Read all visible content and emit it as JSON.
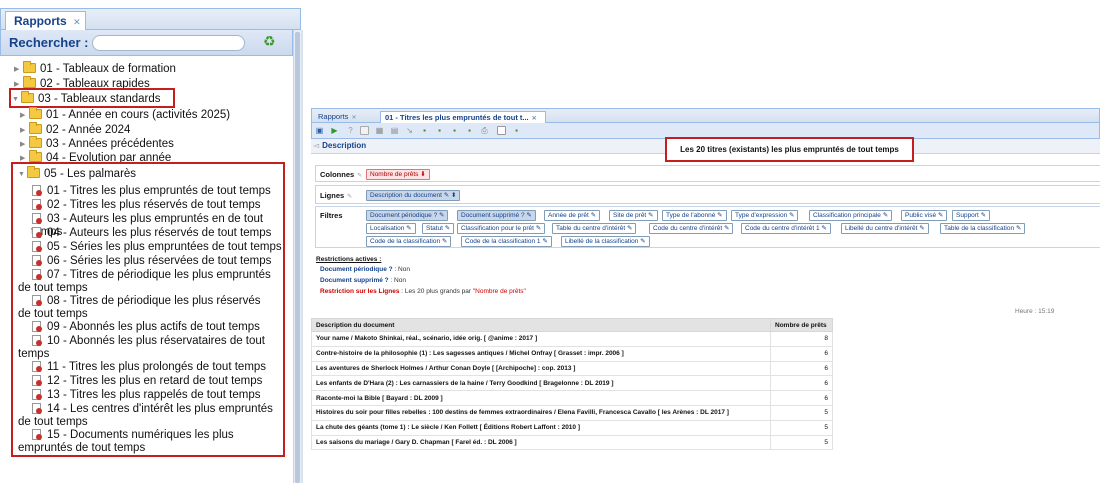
{
  "left": {
    "tab_label": "Rapports",
    "search_label": "Rechercher :",
    "search_value": "",
    "tree": [
      {
        "label": "01 - Tableaux de formation",
        "expanded": false
      },
      {
        "label": "02 - Tableaux rapides",
        "expanded": false
      },
      {
        "label": "03 - Tableaux standards",
        "expanded": true
      }
    ],
    "subtree": [
      {
        "label": "01 - Année en cours (activités 2025)",
        "expanded": false
      },
      {
        "label": "02 - Année 2024",
        "expanded": false
      },
      {
        "label": "03 - Années précédentes",
        "expanded": false
      },
      {
        "label": "04 - Evolution par année",
        "expanded": false
      },
      {
        "label": "05 - Les palmarès",
        "expanded": true
      }
    ],
    "reports": [
      "01 - Titres les plus empruntés de tout temps",
      "02 - Titres les plus réservés de tout temps",
      "03 - Auteurs les plus empruntés en de tout temps",
      "04 - Auteurs les plus réservés de tout temps",
      "05 - Séries les plus empruntées de tout temps",
      "06 - Séries les plus réservées de tout temps",
      "07 - Titres de périodique les plus empruntés de tout temps",
      "08 - Titres de périodique les plus réservés de tout temps",
      "09 - Abonnés les plus actifs de tout temps",
      "10 - Abonnés les plus réservataires de tout temps",
      "11 - Titres les plus prolongés de tout temps",
      "12 - Titres les plus en retard de tout temps",
      "13 - Titres les plus rappelés de tout temps",
      "14 - Les centres d'intérêt les plus empruntés de tout temps",
      "15 - Documents numériques les plus empruntés de tout temps"
    ]
  },
  "right": {
    "tabs": [
      "Rapports",
      "01 - Titres les plus empruntés de tout t..."
    ],
    "description_tab": "Description",
    "report_title": "Les 20 titres (existants) les plus empruntés de tout temps",
    "colonnes_label": "Colonnes",
    "colonnes": [
      "Nombre de prêts"
    ],
    "lignes_label": "Lignes",
    "lignes": [
      "Description du document"
    ],
    "filtres_label": "Filtres",
    "filtres": [
      "Document périodique ?",
      "Document supprimé ?",
      "Année de prêt",
      "Site de prêt",
      "Type de l'abonné",
      "Type d'expression",
      "Classification principale",
      "Public visé",
      "Support",
      "Localisation",
      "Statut",
      "Classification pour le prêt",
      "Table du centre d'intérêt",
      "Code du centre d'intérêt",
      "Code du centre d'intérêt 1",
      "Libellé du centre d'intérêt",
      "Table de la classification",
      "Code de la classification",
      "Code de la classification 1",
      "Libellé de la classification"
    ],
    "restrictions_title": "Restrictions actives :",
    "restrictions": [
      {
        "key": "Document périodique ?",
        "value": "Non",
        "quoted": ""
      },
      {
        "key": "Document supprimé ?",
        "value": "Non",
        "quoted": ""
      },
      {
        "key": "Restriction sur les Lignes",
        "value": "Les 20 plus grands par",
        "quoted": "\"Nombre de prêts\""
      }
    ],
    "heure_label": "Heure",
    "heure_value": "15:19",
    "table": {
      "headers": [
        "Description du document",
        "Nombre de prêts"
      ],
      "rows": [
        [
          "Your name / Makoto Shinkai, réal., scénario, idée orig. [ @anime : 2017 ]",
          "8"
        ],
        [
          "Contre-histoire de la philosophie (1) : Les sagesses antiques / Michel Onfray [ Grasset : impr. 2006 ]",
          "6"
        ],
        [
          "Les aventures de Sherlock Holmes / Arthur Conan Doyle [ [Archipoche] : cop. 2013 ]",
          "6"
        ],
        [
          "Les enfants de D'Hara (2) : Les carnassiers de la haine / Terry Goodkind [ Bragelonne : DL 2019 ]",
          "6"
        ],
        [
          "Raconte-moi la Bible [ Bayard : DL 2009 ]",
          "6"
        ],
        [
          "Histoires du soir pour filles rebelles : 100 destins de femmes extraordinaires / Elena Favilli, Francesca Cavallo [ les Arènes : DL 2017 ]",
          "5"
        ],
        [
          "La chute des géants (tome 1) : Le siècle / Ken Follett [ Éditions Robert Laffont : 2010 ]",
          "5"
        ],
        [
          "Les saisons du mariage / Gary D. Chapman [ Farel éd. : DL 2006 ]",
          "5"
        ]
      ]
    }
  }
}
